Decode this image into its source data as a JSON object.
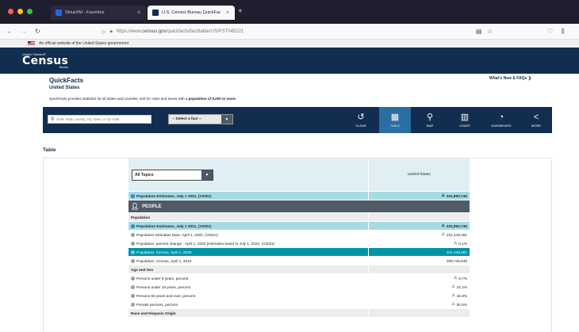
{
  "browser": {
    "tabs": [
      {
        "title": "SiriusXM - Favorites",
        "active": false
      },
      {
        "title": "U.S. Census Bureau QuickFacts: United States",
        "active": true
      }
    ],
    "new_tab_label": "+",
    "url_prefix": "https://www.",
    "url_domain": "census.gov",
    "url_path": "/quickfacts/fact/table/US/PST045221"
  },
  "gov_banner": "An official website of the United States government",
  "logo": {
    "small": "United States®",
    "big": "Census",
    "sub": "Bureau"
  },
  "page": {
    "title": "QuickFacts",
    "subtitle": "United States",
    "description_prefix": "QuickFacts provides statistics for all states and counties, and for cities and towns with a ",
    "description_emphasis": "population of 5,000 or more.",
    "whats_new": "What's New & FAQs ❯"
  },
  "toolbar": {
    "search_placeholder": "Enter state, county, city, town, or zip code",
    "select_fact": "-- Select a fact --",
    "buttons": [
      {
        "label": "CLEAR",
        "icon": "clear-icon"
      },
      {
        "label": "TABLE",
        "icon": "table-icon"
      },
      {
        "label": "MAP",
        "icon": "map-pin-icon"
      },
      {
        "label": "CHART",
        "icon": "chart-icon"
      },
      {
        "label": "DASHBOARD",
        "icon": "dashboard-icon"
      },
      {
        "label": "MORE",
        "icon": "share-icon"
      }
    ]
  },
  "table": {
    "heading": "Table",
    "topics_select": "All Topics",
    "column_header": "United States",
    "rows": [
      {
        "type": "teal-light",
        "info": true,
        "label": "Population Estimates, July 1 2021, (V2021)",
        "warn": true,
        "value": "331,893,745"
      },
      {
        "type": "section",
        "label": "PEOPLE"
      },
      {
        "type": "grey",
        "label": "Population",
        "value": ""
      },
      {
        "type": "teal-light",
        "info": true,
        "label": "Population Estimates, July 1 2021, (V2021)",
        "warn": true,
        "value": "331,893,745"
      },
      {
        "type": "plain",
        "info": true,
        "label": "Population estimates base, April 1, 2020, (V2021)",
        "warn": true,
        "value": "331,449,281"
      },
      {
        "type": "plain",
        "info": true,
        "label": "Population, percent change - April 1, 2020 (estimates base) to July 1, 2021, (V2021)",
        "warn": true,
        "value": "0.1%"
      },
      {
        "type": "teal-dark",
        "info": true,
        "label": "Population, Census, April 1, 2020",
        "warn": false,
        "value": "331,449,281"
      },
      {
        "type": "plain",
        "info": true,
        "label": "Population, Census, April 1, 2010",
        "warn": false,
        "value": "308,745,538"
      },
      {
        "type": "grey",
        "label": "Age and Sex",
        "value": ""
      },
      {
        "type": "plain",
        "info": true,
        "label": "Persons under 5 years, percent",
        "warn": true,
        "value": "5.7%"
      },
      {
        "type": "plain",
        "info": true,
        "label": "Persons under 18 years, percent",
        "warn": true,
        "value": "22.2%"
      },
      {
        "type": "plain",
        "info": true,
        "label": "Persons 65 years and over, percent",
        "warn": true,
        "value": "16.8%"
      },
      {
        "type": "plain",
        "info": true,
        "label": "Female persons, percent",
        "warn": true,
        "value": "50.5%"
      },
      {
        "type": "grey",
        "label": "Race and Hispanic Origin",
        "value": ""
      }
    ]
  },
  "colors": {
    "census_navy": "#112e51",
    "teal_light": "#a6dbe4",
    "teal_dark": "#0093a8",
    "section_grey": "#4f5b66"
  }
}
